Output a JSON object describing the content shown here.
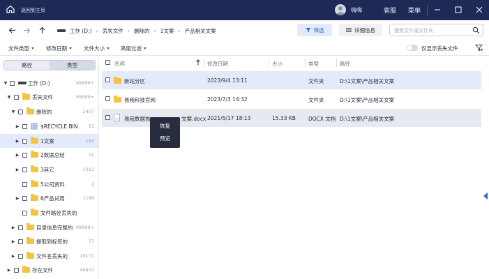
{
  "titlebar": {
    "back_text": "返回到主页",
    "user_name": "嗨嗨",
    "links": [
      "客服",
      "菜单"
    ]
  },
  "nav": {
    "breadcrumb": [
      "工作 (D:)",
      "丢失文件",
      "删除的",
      "1文案",
      "产品相关文案"
    ],
    "filter_label": "筛选",
    "detail_label": "详细信息",
    "search_placeholder": "搜索文件或文件夹"
  },
  "filters": {
    "dropdowns": [
      "文件类型",
      "修改日期",
      "文件大小",
      "高级过滤"
    ],
    "toggle_label": "仅显示丢失文件"
  },
  "sidebar": {
    "tabs": [
      "路径",
      "类型"
    ],
    "tree": [
      {
        "label": "工作 (D:)",
        "count": "99999+",
        "arrow": "▼"
      },
      {
        "label": "丢失文件",
        "count": "99999+",
        "arrow": "▼"
      },
      {
        "label": "删除的",
        "count": "2457",
        "arrow": "▼"
      },
      {
        "label": "$RECYCLE.BIN",
        "count": "51",
        "arrow": "▶"
      },
      {
        "label": "1文案",
        "count": "184",
        "arrow": "▶"
      },
      {
        "label": "2数据总结",
        "count": "12",
        "arrow": "▶"
      },
      {
        "label": "3其它",
        "count": "1013",
        "arrow": "▶"
      },
      {
        "label": "5公司资料",
        "count": "2",
        "arrow": ""
      },
      {
        "label": "6产品试用",
        "count": "1196",
        "arrow": "▶"
      },
      {
        "label": "文件路径丢失的",
        "count": "",
        "arrow": ""
      },
      {
        "label": "目录信息完整的",
        "count": "99999+",
        "arrow": "▶"
      },
      {
        "label": "提取到标签的",
        "count": "77",
        "arrow": "▶"
      },
      {
        "label": "文件名丢失的",
        "count": "19171",
        "arrow": "▶"
      },
      {
        "label": "存在文件",
        "count": "49472",
        "arrow": "▶"
      }
    ]
  },
  "table": {
    "headers": [
      "名称",
      "修改日期",
      "大小",
      "类型",
      "路径"
    ],
    "rows": [
      {
        "name": "新站分区",
        "date": "2023/9/4 13:11",
        "size": "",
        "type": "文件夹",
        "path": "D:\\1文案\\产品相关文案"
      },
      {
        "name": "易我科技官网",
        "date": "2023/7/3 14:32",
        "size": "",
        "type": "文件夹",
        "path": "D:\\1文案\\产品相关文案"
      },
      {
        "name_left": "易我数据恢",
        "name_right": "文案.docx",
        "date": "2021/5/17 18:13",
        "size": "15.33 KB",
        "type": "DOCX 文档",
        "path": "D:\\1文案\\产品相关文案"
      }
    ]
  },
  "context_menu": [
    "恢复",
    "预览"
  ]
}
